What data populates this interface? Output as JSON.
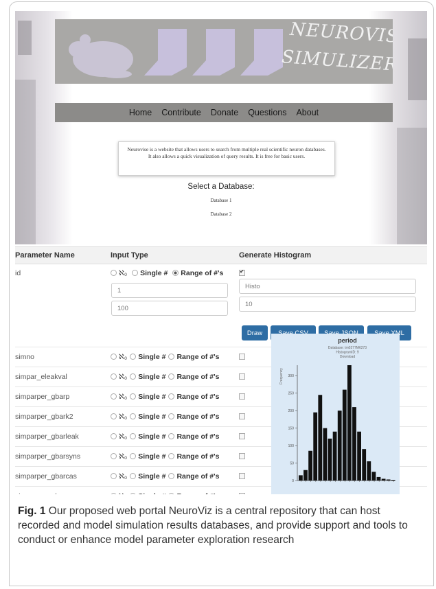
{
  "banner": {
    "title_line1": "NEUROVISE",
    "title_line2": "SIMULIZER"
  },
  "nav": {
    "items": [
      "Home",
      "Contribute",
      "Donate",
      "Questions",
      "About"
    ]
  },
  "intro": {
    "text": "Neurovise is a website that allows users to search from multiple real scientific neuron databases. It also allows a quick visualization of query results. It is free for basic users."
  },
  "database_select": {
    "label": "Select a Database:",
    "options": [
      "Database 1",
      "Database 2"
    ]
  },
  "table": {
    "headers": [
      "Parameter Name",
      "Input Type",
      "Generate Histogram"
    ],
    "radio_labels": [
      "ℵ₀",
      "Single #",
      "Range of #'s"
    ],
    "id_row": {
      "name": "id",
      "range_from": "1",
      "range_to": "100",
      "hist_name": "Histo",
      "hist_bins": "10",
      "buttons": [
        "Draw",
        "Save CSV",
        "Save JSON",
        "Save XML"
      ]
    },
    "rows": [
      "simno",
      "simpar_eleakval",
      "simparper_gbarp",
      "simparper_gbark2",
      "simparper_gbarleak",
      "simparper_gbarsyns",
      "simparper_gbarcas",
      "simparper_gbarsyng"
    ]
  },
  "chart_data": {
    "type": "bar",
    "title": "period",
    "subtitle_lines": [
      "Database: tm0277M6273",
      "HistogramID: 9",
      "Download"
    ],
    "ylabel": "Frequency",
    "ylim": [
      0,
      330
    ],
    "yticks": [
      0,
      50,
      100,
      150,
      200,
      250,
      300
    ],
    "values": [
      15,
      30,
      85,
      195,
      245,
      150,
      120,
      140,
      200,
      260,
      330,
      210,
      140,
      90,
      55,
      25,
      10,
      5,
      3,
      2
    ],
    "colors": {
      "bar": "#111111",
      "panel": "#dbe9f6"
    }
  },
  "caption": {
    "label": "Fig. 1",
    "text": " Our proposed web portal NeuroViz is a central repository that can host recorded and model simulation results databases, and provide support and tools to conduct or enhance model parameter exploration research"
  }
}
